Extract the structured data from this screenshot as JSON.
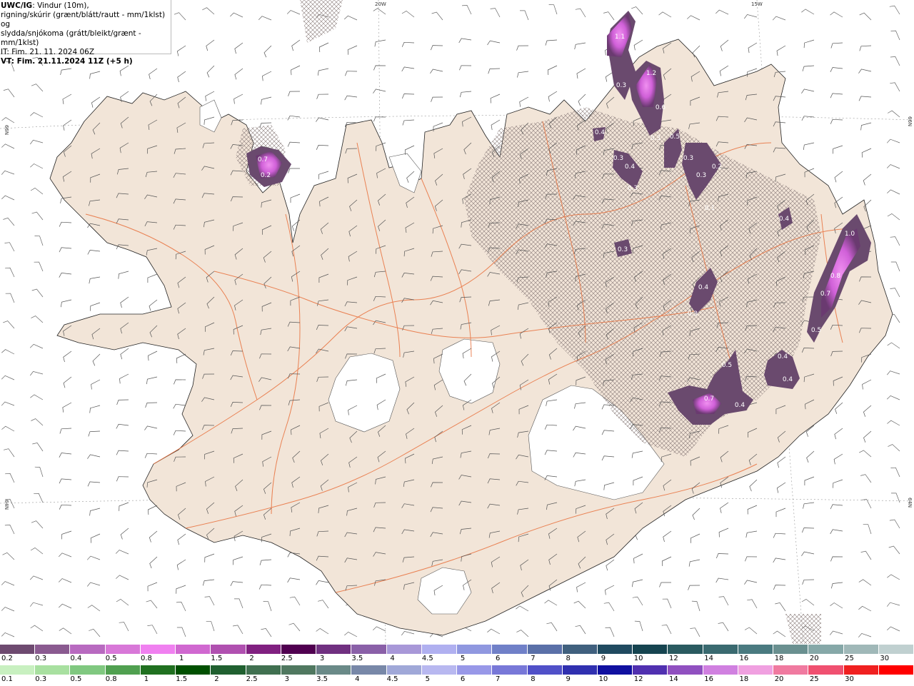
{
  "info": {
    "title_code": "UWC/IG",
    "line1_rest": ": Vindur (10m),",
    "line2": "rigning/skúrir (grænt/blátt/rautt - mm/1klst) og",
    "line3": "slydda/snjókoma (grátt/bleikt/grænt - mm/1klst)",
    "line4": "IT: Fim. 21. 11. 2024 06Z",
    "line5": "VT: Fim. 21.11.2024 11Z (+5 h)"
  },
  "grid_labels": {
    "top_20w": "20W",
    "top_15w": "15W",
    "left_66n": "66N",
    "right_66n": "66N",
    "left_64n": "64N",
    "right_64n": "64N"
  },
  "precip_labels": [
    "1.1",
    "0.3",
    "1.2",
    "0.6",
    "0.3",
    "0.5",
    "0.7",
    "0.2",
    "0.4",
    "0.3",
    "0.4",
    "0.3",
    "0.3",
    "0.3",
    "0.2",
    "0.1",
    "0.4",
    "0.3",
    "1.0",
    "0.8",
    "0.7",
    "0.4",
    "0.5",
    "0.5",
    "0.4",
    "0.4",
    "0.7",
    "0.4",
    "0.3"
  ],
  "legend_snow": {
    "ticks": [
      "0.2",
      "0.3",
      "0.4",
      "0.5",
      "0.8",
      "1",
      "1.5",
      "2",
      "2.5",
      "3",
      "3.5",
      "4",
      "4.5",
      "5",
      "6",
      "7",
      "8",
      "9",
      "10",
      "12",
      "14",
      "16",
      "18",
      "20",
      "25",
      "30"
    ],
    "colors": [
      "#6e4a70",
      "#8a5a90",
      "#b86ac0",
      "#d878d8",
      "#f080f0",
      "#d068d0",
      "#b050b0",
      "#802080",
      "#500050",
      "#703080",
      "#8a60a8",
      "#a898d8",
      "#b0b0f0",
      "#9098e0",
      "#7080c8",
      "#5a70a8",
      "#40607e",
      "#204a60",
      "#164450",
      "#2a5a60",
      "#3a6a70",
      "#4a7a80",
      "#6a9090",
      "#86a8a8",
      "#a0b8b8",
      "#c0d0d0"
    ]
  },
  "legend_rain": {
    "ticks": [
      "0.1",
      "0.3",
      "0.5",
      "0.8",
      "1",
      "1.5",
      "2",
      "2.5",
      "3",
      "3.5",
      "4",
      "4.5",
      "5",
      "6",
      "7",
      "8",
      "9",
      "10",
      "12",
      "14",
      "16",
      "18",
      "20",
      "25",
      "30"
    ],
    "colors": [
      "#c8f0c0",
      "#a8e0a0",
      "#80c880",
      "#50a050",
      "#207020",
      "#005000",
      "#206030",
      "#407050",
      "#507860",
      "#6a8a88",
      "#7888a8",
      "#a0a8d8",
      "#b8b8f0",
      "#9898e8",
      "#7878d8",
      "#5050c8",
      "#3030b0",
      "#1010a0",
      "#5030b0",
      "#9050c0",
      "#d080e0",
      "#f0a0e0",
      "#f07aa0",
      "#f05070",
      "#f02020",
      "#ff0000"
    ]
  },
  "colors": {
    "land": "#f2e5d8",
    "glacier": "#ffffff",
    "sea": "#ffffff",
    "roads": "#e8703c",
    "coast": "#222222",
    "precip_light": "#6a4a6e",
    "precip_mid": "#8a4a94",
    "precip_heavy": "#e070e8"
  }
}
